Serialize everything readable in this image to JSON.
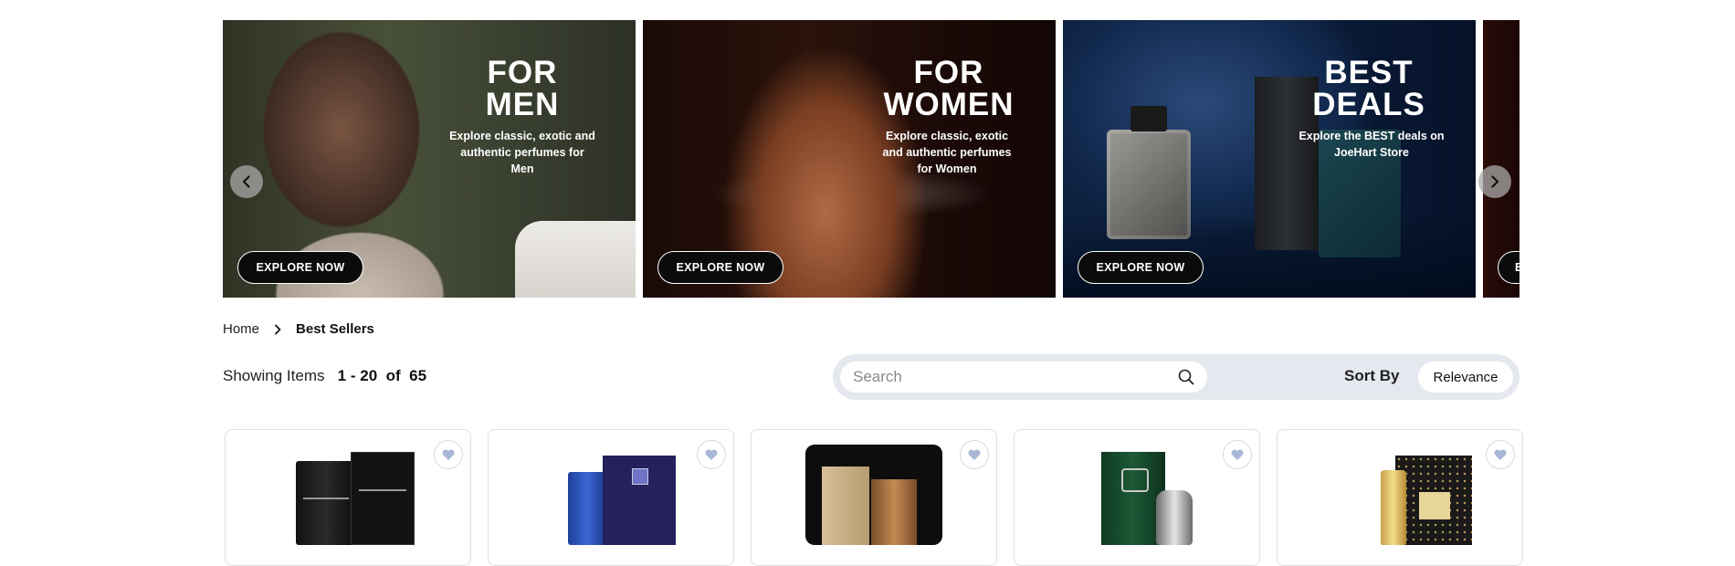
{
  "carousel": {
    "slides": [
      {
        "title": "FOR MEN",
        "description": "Explore classic, exotic and authentic perfumes for Men",
        "button": "EXPLORE NOW"
      },
      {
        "title": "FOR WOMEN",
        "description": "Explore classic, exotic and authentic perfumes for Women",
        "button": "EXPLORE NOW"
      },
      {
        "title": "BEST DEALS",
        "description": "Explore the BEST deals on JoeHart Store",
        "button": "EXPLORE NOW"
      }
    ],
    "partial_button": "E"
  },
  "breadcrumb": {
    "home": "Home",
    "current": "Best Sellers"
  },
  "listing": {
    "showing_label": "Showing Items",
    "range": "1 - 20",
    "of_label": "of",
    "total": "65"
  },
  "search": {
    "placeholder": "Search",
    "value": ""
  },
  "sort": {
    "label": "Sort By",
    "selected": "Relevance"
  },
  "products": [
    {
      "icon": "bvlgari-man-in-black-bottle"
    },
    {
      "icon": "azure-aoud-bottle"
    },
    {
      "icon": "wood-perfume-bottle"
    },
    {
      "icon": "green-box-silver-bottle"
    },
    {
      "icon": "sultan-gold-bottle"
    }
  ],
  "colors": {
    "toolbar_bg": "#e5e8ee",
    "button_bg": "#0b0b0b",
    "heart": "#a9b7d6"
  }
}
